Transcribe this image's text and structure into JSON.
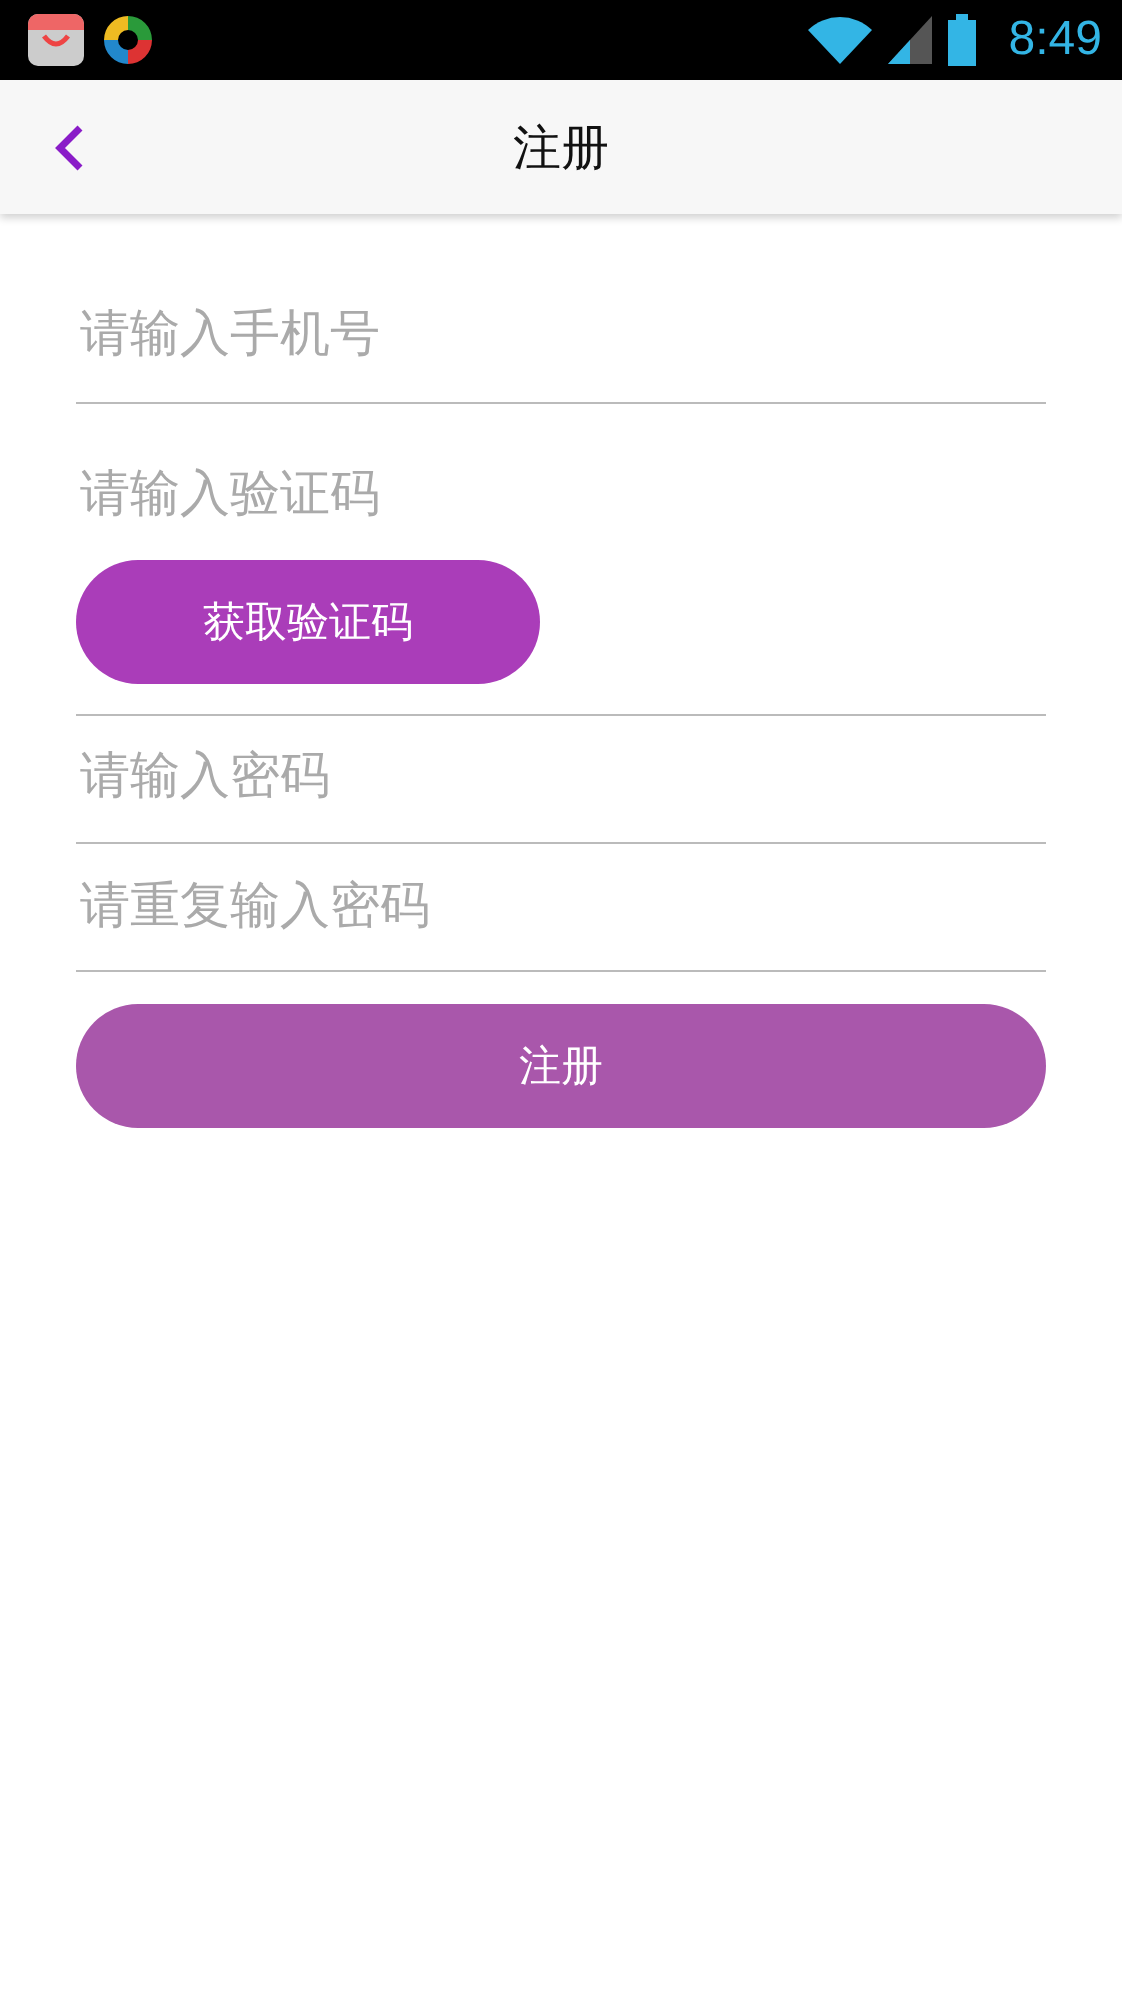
{
  "status_bar": {
    "time": "8:49"
  },
  "app_bar": {
    "title": "注册"
  },
  "fields": [
    {
      "kind": "text",
      "placeholder": "请输入手机号"
    },
    {
      "kind": "code",
      "placeholder": "请输入验证码",
      "button": "获取验证码"
    },
    {
      "kind": "text",
      "placeholder": "请输入密码"
    },
    {
      "kind": "text",
      "placeholder": "请重复输入密码"
    }
  ],
  "register_button": {
    "label": "注册"
  }
}
